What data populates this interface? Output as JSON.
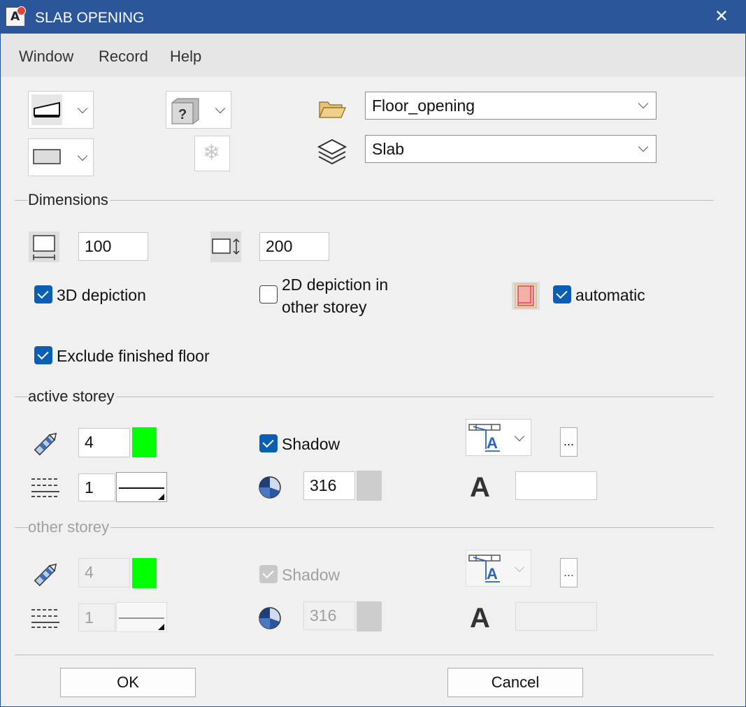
{
  "window": {
    "title": "SLAB OPENING",
    "close_glyph": "✕",
    "app_icon_letter": "A"
  },
  "menu": [
    "Window",
    "Record",
    "Help"
  ],
  "top": {
    "folder_combo": "Floor_opening",
    "layer_combo": "Slab",
    "help_glyph": "?",
    "freeze_glyph": "❄"
  },
  "dimensions": {
    "label": "Dimensions",
    "width": "100",
    "depth": "200",
    "depiction_3d": {
      "label": "3D depiction",
      "checked": true
    },
    "depiction_2d": {
      "label_line1": "2D depiction in",
      "label_line2": "other storey",
      "checked": false
    },
    "automatic": {
      "label": "automatic",
      "checked": true
    },
    "exclude_floor": {
      "label": "Exclude finished floor",
      "checked": true
    }
  },
  "active_storey": {
    "label": "active storey",
    "pen": "4",
    "line": "1",
    "shadow": {
      "label": "Shadow",
      "checked": true
    },
    "pattern": "316",
    "more_label": "...",
    "text_glyph": "A",
    "text_value": ""
  },
  "other_storey": {
    "label": "other storey",
    "pen": "4",
    "line": "1",
    "shadow": {
      "label": "Shadow",
      "checked": true
    },
    "pattern": "316",
    "more_label": "...",
    "text_glyph": "A",
    "text_value": ""
  },
  "buttons": {
    "ok": "OK",
    "cancel": "Cancel"
  },
  "colors": {
    "title_bar": "#2b579a",
    "pen_color": "#00ff00",
    "check_blue": "#0a5fb4"
  }
}
